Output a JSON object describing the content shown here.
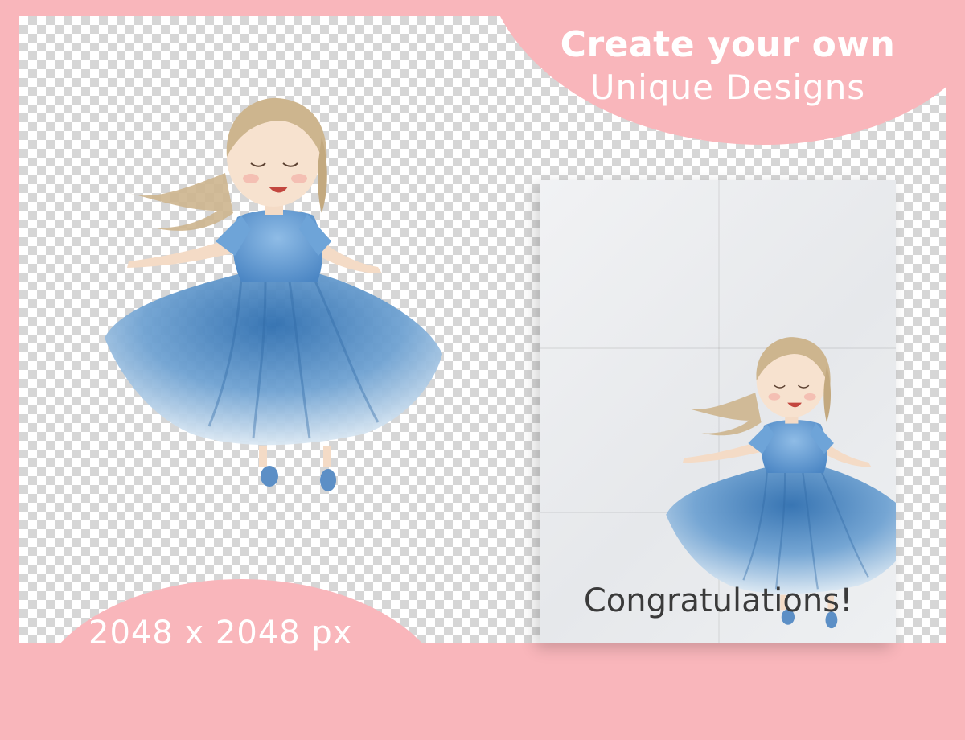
{
  "banner": {
    "line1": "Create your own",
    "line2": "Unique Designs"
  },
  "resolution_label": "2048 x 2048 px",
  "card": {
    "message": "Congratulations!"
  },
  "colors": {
    "frame_pink": "#f9b6bb",
    "dress_blue": "#4a86c2",
    "hair_blonde": "#cdb58e",
    "skin": "#f4dbc6"
  }
}
